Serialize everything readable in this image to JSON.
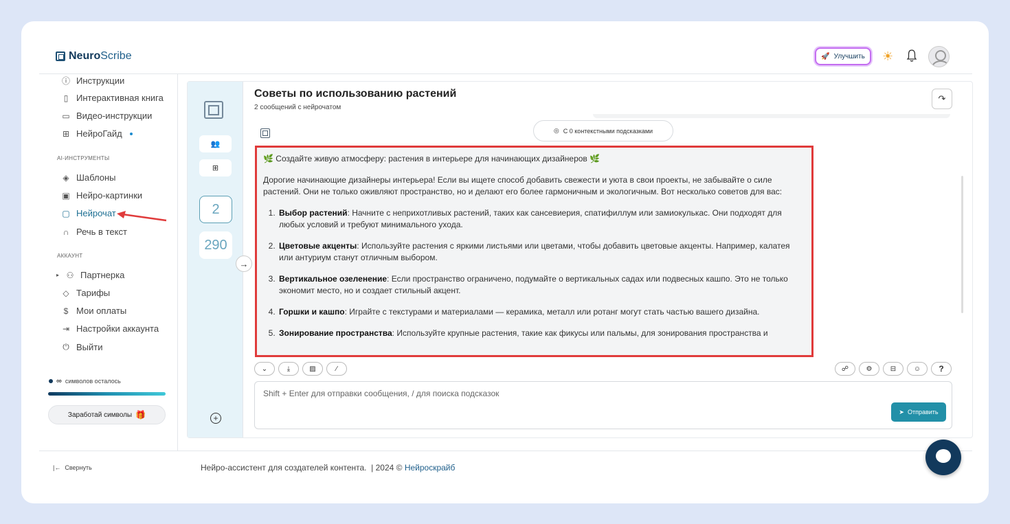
{
  "app": {
    "logo_bold": "Neuro",
    "logo_light": "Scribe",
    "upgrade_label": "Улучшить"
  },
  "sidebar": {
    "items_top": [
      {
        "label": "Инструкции",
        "icon": "question-icon"
      },
      {
        "label": "Интерактивная книга",
        "icon": "book-icon"
      },
      {
        "label": "Видео-инструкции",
        "icon": "video-icon"
      },
      {
        "label": "НейроГайд",
        "icon": "guide-icon"
      }
    ],
    "section_ai": "AI-ИНСТРУМЕНТЫ",
    "items_ai": [
      {
        "label": "Шаблоны",
        "icon": "layers-icon"
      },
      {
        "label": "Нейро-картинки",
        "icon": "image-icon"
      },
      {
        "label": "Нейрочат",
        "icon": "chat-icon"
      },
      {
        "label": "Речь в текст",
        "icon": "headphones-icon"
      }
    ],
    "section_account": "АККАУНТ",
    "items_account": [
      {
        "label": "Партнерка",
        "icon": "users-icon"
      },
      {
        "label": "Тарифы",
        "icon": "tag-icon"
      },
      {
        "label": "Мои оплаты",
        "icon": "dollar-icon"
      },
      {
        "label": "Настройки аккаунта",
        "icon": "login-icon"
      },
      {
        "label": "Выйти",
        "icon": "power-icon"
      }
    ],
    "chars_symbol": "∞",
    "chars_label": "символов осталось",
    "earn_label": "Заработай символы",
    "collapse_label": "Свернуть"
  },
  "chat": {
    "title": "Советы по использованию растений",
    "subtitle": "2 сообщений с нейрочатом",
    "hints_label": "С 0 контекстными подсказками",
    "rail_count_1": "2",
    "rail_count_2": "290",
    "message": {
      "heading": "Создайте живую атмосферу: растения в интерьере для начинающих дизайнеров",
      "intro": "Дорогие начинающие дизайнеры интерьера! Если вы ищете способ добавить свежести и уюта в свои проекты, не забывайте о силе растений. Они не только оживляют пространство, но и делают его более гармоничным и экологичным. Вот несколько советов для вас:",
      "tips": [
        {
          "title": "Выбор растений",
          "text": ": Начните с неприхотливых растений, таких как сансевиерия, спатифиллум или замиокулькас. Они подходят для любых условий и требуют минимального ухода."
        },
        {
          "title": "Цветовые акценты",
          "text": ": Используйте растения с яркими листьями или цветами, чтобы добавить цветовые акценты. Например, калатея или антуриум станут отличным выбором."
        },
        {
          "title": "Вертикальное озеленение",
          "text": ": Если пространство ограничено, подумайте о вертикальных садах или подвесных кашпо. Это не только экономит место, но и создает стильный акцент."
        },
        {
          "title": "Горшки и кашпо",
          "text": ": Играйте с текстурами и материалами — керамика, металл или ротанг могут стать частью вашего дизайна."
        },
        {
          "title": "Зонирование пространства",
          "text": ": Используйте крупные растения, такие как фикусы или пальмы, для зонирования пространства и"
        }
      ]
    },
    "input_placeholder": "Shift + Enter для отправки сообщения, / для поиска подсказок",
    "send_label": "Отправить"
  },
  "footer": {
    "text": "Нейро-ассистент для создателей контента.  | 2024 © ",
    "brand": "Нейроскрайб"
  },
  "colors": {
    "accent": "#1d6f93",
    "highlight_border": "#e03b3b",
    "send_button": "#2290a8",
    "fab": "#12395c"
  }
}
